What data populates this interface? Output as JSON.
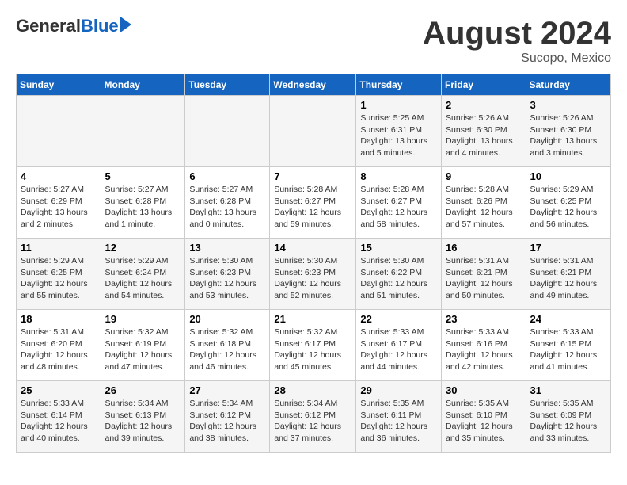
{
  "logo": {
    "general": "General",
    "blue": "Blue"
  },
  "title": {
    "month": "August 2024",
    "location": "Sucopo, Mexico"
  },
  "headers": [
    "Sunday",
    "Monday",
    "Tuesday",
    "Wednesday",
    "Thursday",
    "Friday",
    "Saturday"
  ],
  "weeks": [
    [
      {
        "day": "",
        "info": ""
      },
      {
        "day": "",
        "info": ""
      },
      {
        "day": "",
        "info": ""
      },
      {
        "day": "",
        "info": ""
      },
      {
        "day": "1",
        "info": "Sunrise: 5:25 AM\nSunset: 6:31 PM\nDaylight: 13 hours\nand 5 minutes."
      },
      {
        "day": "2",
        "info": "Sunrise: 5:26 AM\nSunset: 6:30 PM\nDaylight: 13 hours\nand 4 minutes."
      },
      {
        "day": "3",
        "info": "Sunrise: 5:26 AM\nSunset: 6:30 PM\nDaylight: 13 hours\nand 3 minutes."
      }
    ],
    [
      {
        "day": "4",
        "info": "Sunrise: 5:27 AM\nSunset: 6:29 PM\nDaylight: 13 hours\nand 2 minutes."
      },
      {
        "day": "5",
        "info": "Sunrise: 5:27 AM\nSunset: 6:28 PM\nDaylight: 13 hours\nand 1 minute."
      },
      {
        "day": "6",
        "info": "Sunrise: 5:27 AM\nSunset: 6:28 PM\nDaylight: 13 hours\nand 0 minutes."
      },
      {
        "day": "7",
        "info": "Sunrise: 5:28 AM\nSunset: 6:27 PM\nDaylight: 12 hours\nand 59 minutes."
      },
      {
        "day": "8",
        "info": "Sunrise: 5:28 AM\nSunset: 6:27 PM\nDaylight: 12 hours\nand 58 minutes."
      },
      {
        "day": "9",
        "info": "Sunrise: 5:28 AM\nSunset: 6:26 PM\nDaylight: 12 hours\nand 57 minutes."
      },
      {
        "day": "10",
        "info": "Sunrise: 5:29 AM\nSunset: 6:25 PM\nDaylight: 12 hours\nand 56 minutes."
      }
    ],
    [
      {
        "day": "11",
        "info": "Sunrise: 5:29 AM\nSunset: 6:25 PM\nDaylight: 12 hours\nand 55 minutes."
      },
      {
        "day": "12",
        "info": "Sunrise: 5:29 AM\nSunset: 6:24 PM\nDaylight: 12 hours\nand 54 minutes."
      },
      {
        "day": "13",
        "info": "Sunrise: 5:30 AM\nSunset: 6:23 PM\nDaylight: 12 hours\nand 53 minutes."
      },
      {
        "day": "14",
        "info": "Sunrise: 5:30 AM\nSunset: 6:23 PM\nDaylight: 12 hours\nand 52 minutes."
      },
      {
        "day": "15",
        "info": "Sunrise: 5:30 AM\nSunset: 6:22 PM\nDaylight: 12 hours\nand 51 minutes."
      },
      {
        "day": "16",
        "info": "Sunrise: 5:31 AM\nSunset: 6:21 PM\nDaylight: 12 hours\nand 50 minutes."
      },
      {
        "day": "17",
        "info": "Sunrise: 5:31 AM\nSunset: 6:21 PM\nDaylight: 12 hours\nand 49 minutes."
      }
    ],
    [
      {
        "day": "18",
        "info": "Sunrise: 5:31 AM\nSunset: 6:20 PM\nDaylight: 12 hours\nand 48 minutes."
      },
      {
        "day": "19",
        "info": "Sunrise: 5:32 AM\nSunset: 6:19 PM\nDaylight: 12 hours\nand 47 minutes."
      },
      {
        "day": "20",
        "info": "Sunrise: 5:32 AM\nSunset: 6:18 PM\nDaylight: 12 hours\nand 46 minutes."
      },
      {
        "day": "21",
        "info": "Sunrise: 5:32 AM\nSunset: 6:17 PM\nDaylight: 12 hours\nand 45 minutes."
      },
      {
        "day": "22",
        "info": "Sunrise: 5:33 AM\nSunset: 6:17 PM\nDaylight: 12 hours\nand 44 minutes."
      },
      {
        "day": "23",
        "info": "Sunrise: 5:33 AM\nSunset: 6:16 PM\nDaylight: 12 hours\nand 42 minutes."
      },
      {
        "day": "24",
        "info": "Sunrise: 5:33 AM\nSunset: 6:15 PM\nDaylight: 12 hours\nand 41 minutes."
      }
    ],
    [
      {
        "day": "25",
        "info": "Sunrise: 5:33 AM\nSunset: 6:14 PM\nDaylight: 12 hours\nand 40 minutes."
      },
      {
        "day": "26",
        "info": "Sunrise: 5:34 AM\nSunset: 6:13 PM\nDaylight: 12 hours\nand 39 minutes."
      },
      {
        "day": "27",
        "info": "Sunrise: 5:34 AM\nSunset: 6:12 PM\nDaylight: 12 hours\nand 38 minutes."
      },
      {
        "day": "28",
        "info": "Sunrise: 5:34 AM\nSunset: 6:12 PM\nDaylight: 12 hours\nand 37 minutes."
      },
      {
        "day": "29",
        "info": "Sunrise: 5:35 AM\nSunset: 6:11 PM\nDaylight: 12 hours\nand 36 minutes."
      },
      {
        "day": "30",
        "info": "Sunrise: 5:35 AM\nSunset: 6:10 PM\nDaylight: 12 hours\nand 35 minutes."
      },
      {
        "day": "31",
        "info": "Sunrise: 5:35 AM\nSunset: 6:09 PM\nDaylight: 12 hours\nand 33 minutes."
      }
    ]
  ]
}
